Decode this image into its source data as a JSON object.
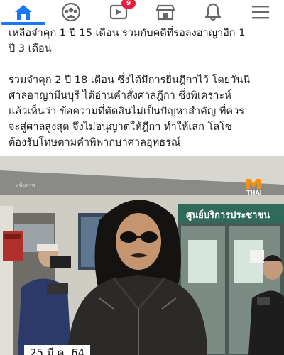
{
  "nav": {
    "items": [
      {
        "icon": "home-icon",
        "active": true
      },
      {
        "icon": "groups-icon"
      },
      {
        "icon": "watch-icon",
        "badge": "9"
      },
      {
        "icon": "marketplace-icon"
      },
      {
        "icon": "notifications-icon"
      },
      {
        "icon": "menu-icon"
      }
    ],
    "accent_color": "#1877f2",
    "badge_color": "#e41e3f"
  },
  "post": {
    "paragraph_1": "เหลือจำคุก 1 ปี 15 เดือน รวมกับคดีที่รอลงอาญาอีก 1\nปี 3 เดือน",
    "paragraph_2": "รวมจำคุก 2 ปี 18 เดือน ซึ่งได้มีการยื่นฎีกาไว้ โดยวันนี\nศาลอาญามีนบุรี ได้อ่านคำสั่งศาลฎีกา ซึ่งพิเคราะห์\nแล้วเห็นว่า ข้อความที่ตัดสินไม่เป็นปัญหาสำคัญ ที่ควร\nจะสู่ศาลสูงสุด จึงไม่อนุญาตให้ฎีกา ทำให้เสก โลโซ\nต้องรับโทษตามคำพิพากษาศาลอุทธรณ์"
  },
  "photo": {
    "watermark": "แฟ้มภาพ",
    "channel_logo": "THAI",
    "sign_text": "ศูนย์บริการประชาชน",
    "date_badge": "25 มี.ค. 64"
  }
}
